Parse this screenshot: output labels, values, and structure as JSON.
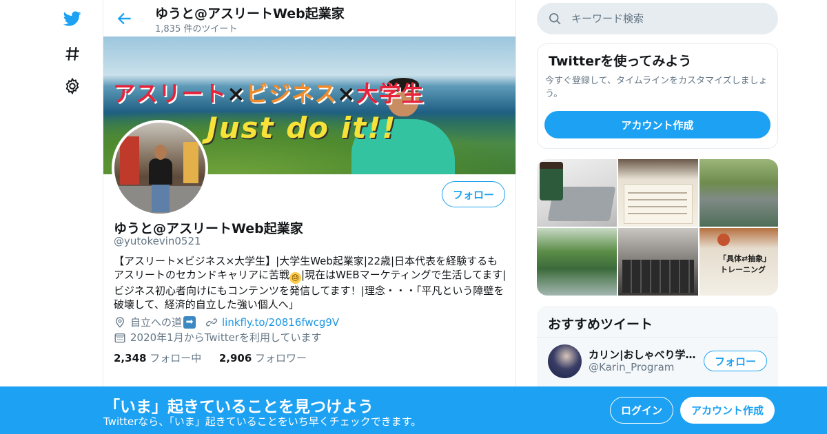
{
  "colors": {
    "accent": "#1da1f2",
    "secondary_text": "#657786",
    "border": "#e6ecf0",
    "link": "#1b95e0"
  },
  "nav": {
    "items": [
      {
        "icon": "twitter-bird-icon"
      },
      {
        "icon": "hashtag-icon"
      },
      {
        "icon": "gear-icon"
      }
    ]
  },
  "header": {
    "name": "ゆうと@アスリートWeb起業家",
    "tweet_count": "1,835 件のツイート",
    "back_icon": "back-arrow-icon"
  },
  "banner": {
    "headline_part1": "アスリート",
    "headline_x1": "×",
    "headline_part2": "ビジネス",
    "headline_x2": "×",
    "headline_part3": "大学生",
    "slogan": "Just do it!!"
  },
  "profile": {
    "follow_label": "フォロー",
    "name": "ゆうと@アスリートWeb起業家",
    "handle": "@yutokevin0521",
    "bio_part1": "【アスリート×ビジネス×大学生】|大学生Web起業家|22歳|日本代表を経験するもアスリートのセカンドキャリアに苦戦",
    "bio_part2": "|現在はWEBマーケティングで生活してます|ビジネス初心者向けにもコンテンツを発信してます！|理念・・・「平凡という障壁を破壊して、経済的自立した強い個人へ」",
    "location": "自立への道",
    "url": "linkfly.to/20816fwcg9V",
    "joined": "2020年1月からTwitterを利用しています",
    "following_count": "2,348",
    "following_label": "フォロー中",
    "followers_count": "2,906",
    "followers_label": "フォロワー"
  },
  "search": {
    "placeholder": "キーワード検索"
  },
  "signup_card": {
    "title": "Twitterを使ってみよう",
    "description": "今すぐ登録して、タイムラインをカスタマイズしましょう。",
    "button_label": "アカウント作成"
  },
  "media": {
    "m6_title1": "「具体⇄抽象」",
    "m6_title2": "トレーニング"
  },
  "recommended": {
    "title": "おすすめツイート",
    "user_name": "カリン|おしゃべり学…",
    "user_handle": "@Karin_Program",
    "follow_label": "フォロー"
  },
  "bottom_bar": {
    "title": "「いま」起きていることを見つけよう",
    "subtitle": "Twitterなら、「いま」起きていることをいち早くチェックできます。",
    "login_label": "ログイン",
    "signup_label": "アカウント作成"
  }
}
